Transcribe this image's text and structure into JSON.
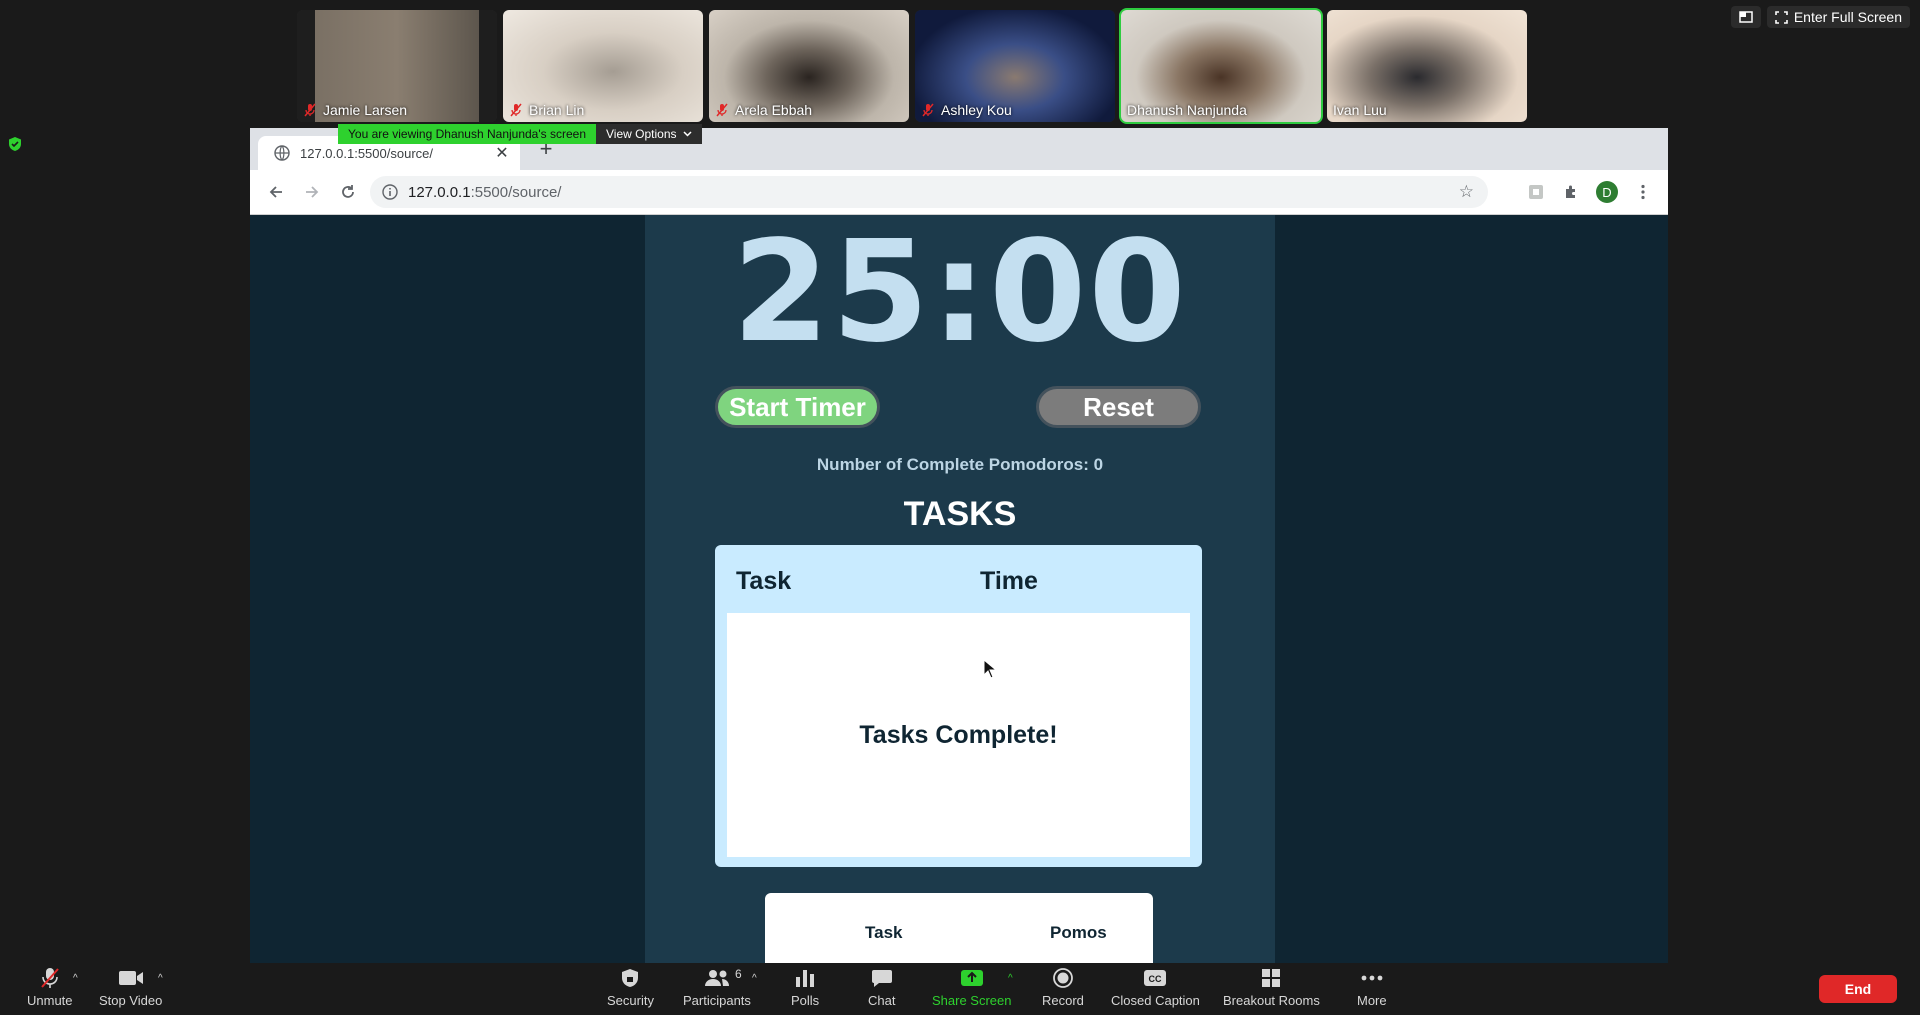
{
  "zoom": {
    "participants": [
      {
        "name": "Jamie Larsen",
        "muted": true,
        "bg": "#6b6255"
      },
      {
        "name": "Brian Lin",
        "muted": true,
        "bg": "#d8cfc4"
      },
      {
        "name": "Arela Ebbah",
        "muted": true,
        "bg": "#b7aea2"
      },
      {
        "name": "Ashley Kou",
        "muted": true,
        "bg": "#1b2a55"
      },
      {
        "name": "Dhanush Nanjunda",
        "muted": false,
        "bg": "#c7c1b8",
        "active": true
      },
      {
        "name": "Ivan Luu",
        "muted": false,
        "bg": "#e6d6c6"
      }
    ],
    "enter_full_screen": "Enter Full Screen",
    "viewing_banner": "You are viewing Dhanush Nanjunda's screen",
    "view_options": "View Options",
    "toolbar": {
      "unmute": "Unmute",
      "stop_video": "Stop Video",
      "security": "Security",
      "participants": "Participants",
      "participants_count": "6",
      "polls": "Polls",
      "chat": "Chat",
      "share_screen": "Share Screen",
      "record": "Record",
      "closed_caption": "Closed Caption",
      "breakout_rooms": "Breakout Rooms",
      "more": "More",
      "end": "End"
    }
  },
  "browser": {
    "tab_title": "127.0.0.1:5500/source/",
    "url_host": "127.0.0.1",
    "url_rest": ":5500/source/",
    "avatar_letter": "D"
  },
  "app": {
    "timer": "25:00",
    "start_label": "Start Timer",
    "reset_label": "Reset",
    "pomodoro_count": "Number of Complete Pomodoros: 0",
    "tasks_title": "TASKS",
    "task_header": "Task",
    "time_header": "Time",
    "tasks_complete": "Tasks Complete!",
    "log_task_header": "Task",
    "log_pomos_header": "Pomos"
  },
  "colors": {
    "accent_green": "#2ed12e",
    "page_bg": "#0f2532",
    "column_bg": "#1c3a4b",
    "timer_text": "#c4dff0",
    "start_btn": "#7fd47f",
    "reset_btn": "#7c7c7c",
    "task_card": "#c9ebff",
    "end_btn": "#e02828"
  }
}
